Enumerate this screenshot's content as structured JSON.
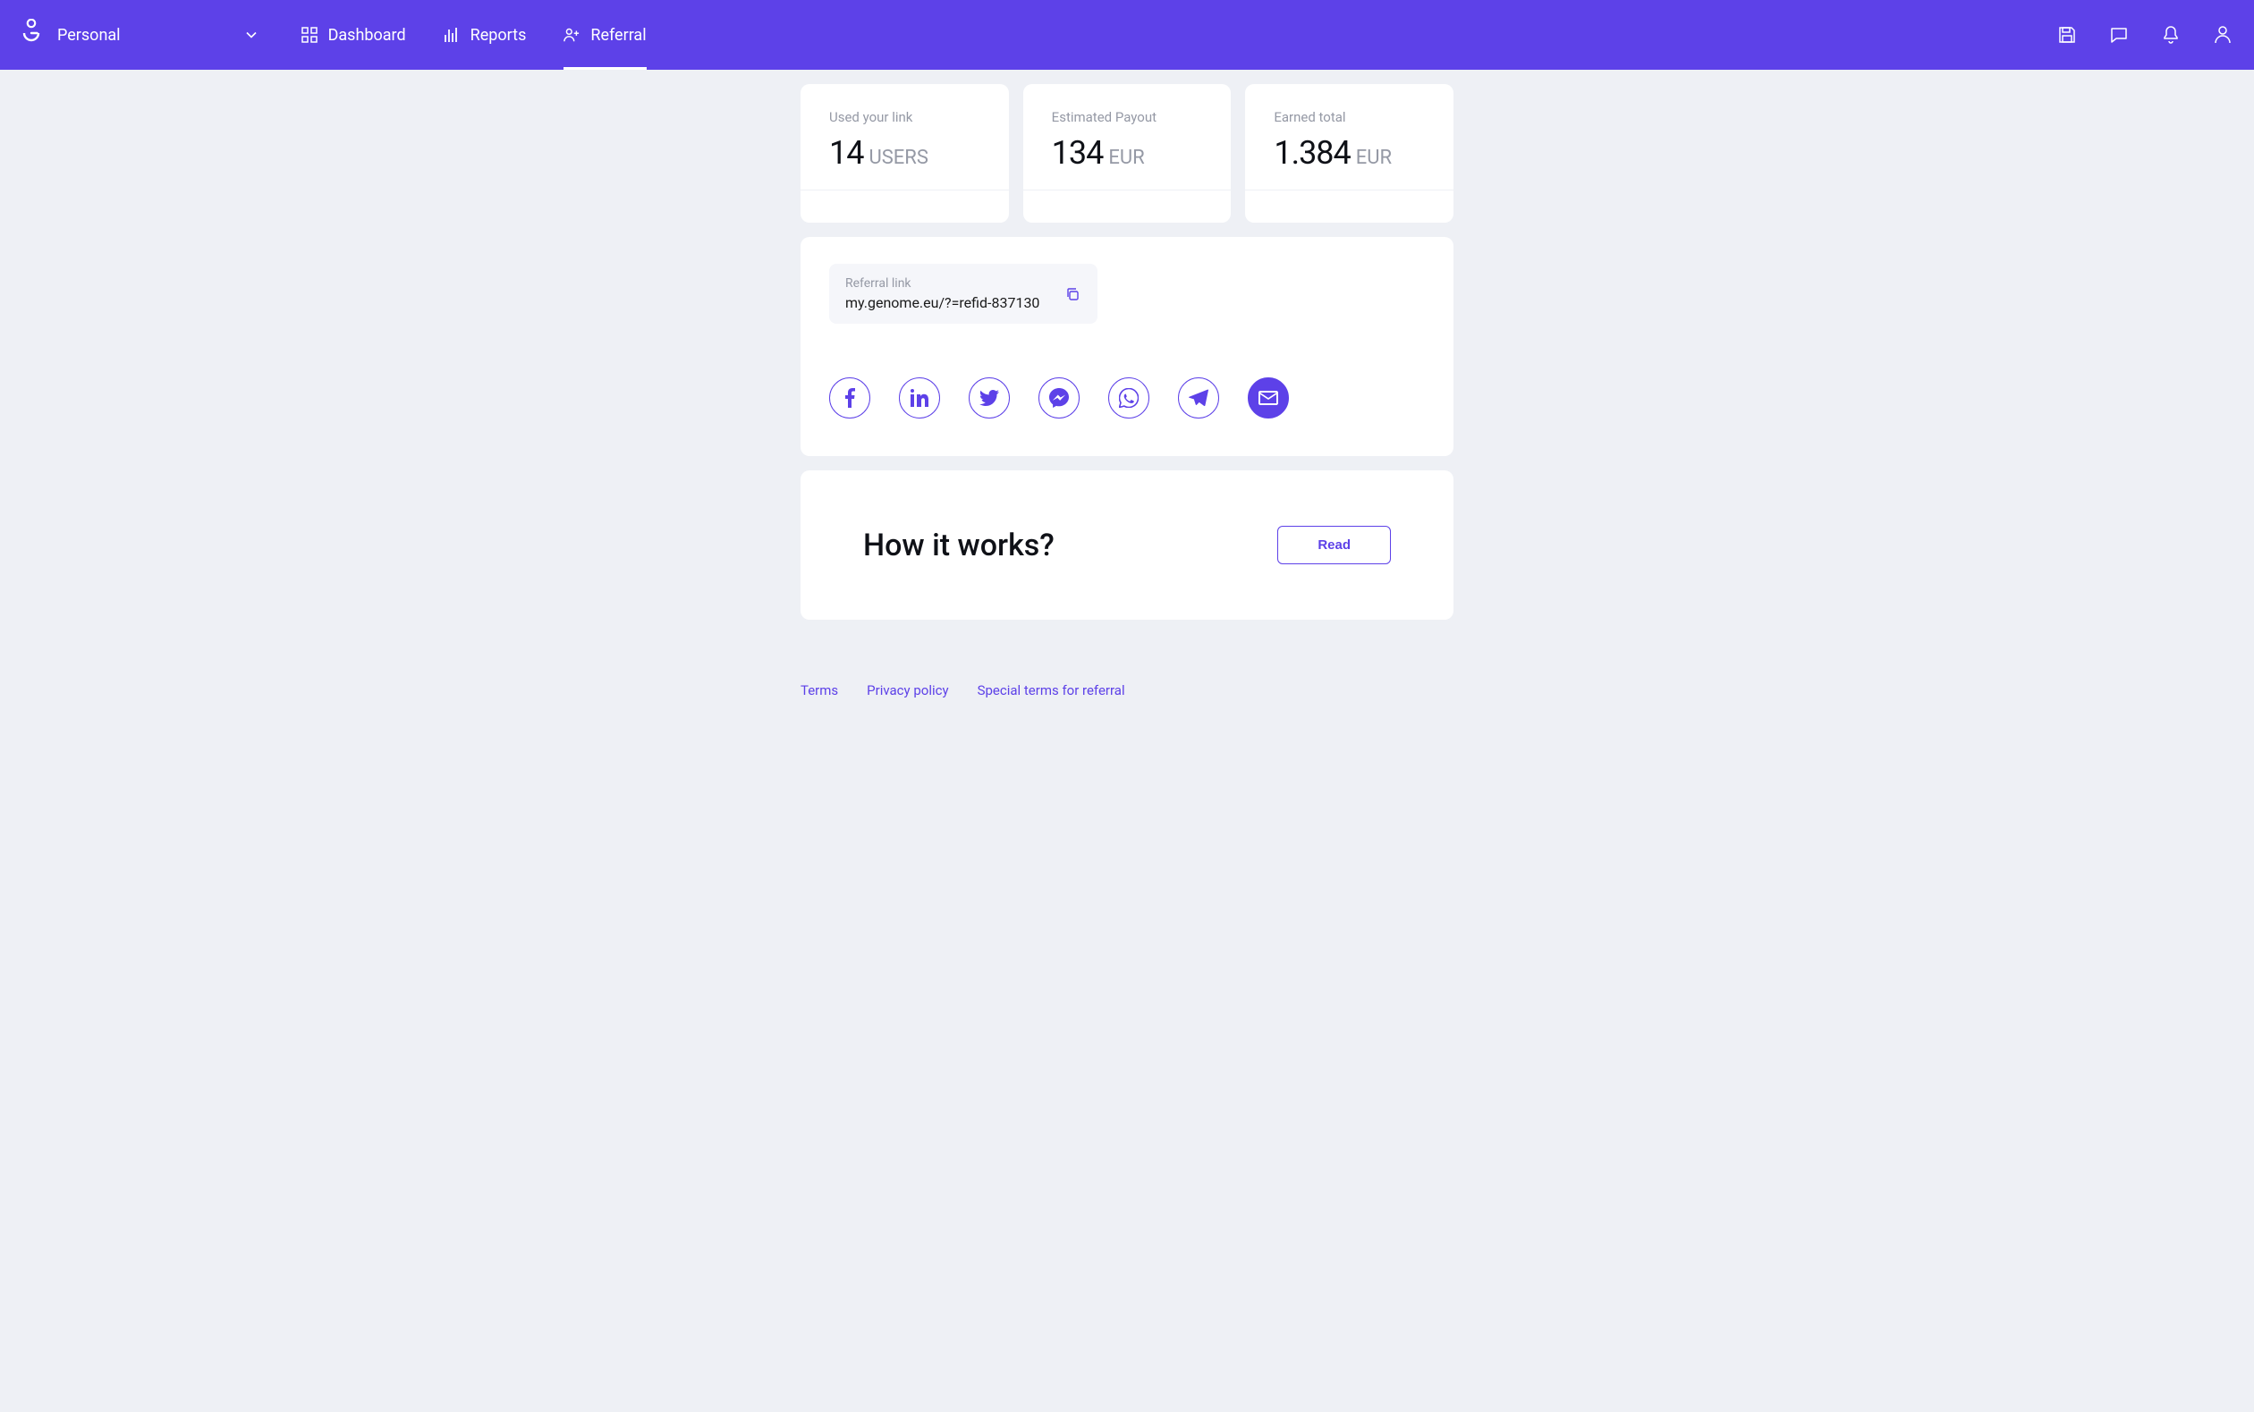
{
  "header": {
    "workspace_label": "Personal",
    "nav": {
      "dashboard": "Dashboard",
      "reports": "Reports",
      "referral": "Referral"
    }
  },
  "stats": {
    "used_link": {
      "label": "Used your link",
      "value": "14",
      "unit": "USERS"
    },
    "estimated_payout": {
      "label": "Estimated Payout",
      "value": "134",
      "unit": "EUR"
    },
    "earned_total": {
      "label": "Earned total",
      "value": "1.384",
      "unit": "EUR"
    }
  },
  "referral": {
    "link_label": "Referral link",
    "link_value": "my.genome.eu/?=refid-837130"
  },
  "howitworks": {
    "title": "How it works?",
    "button": "Read"
  },
  "footer": {
    "terms": "Terms",
    "privacy": "Privacy policy",
    "special": "Special terms for referral"
  }
}
